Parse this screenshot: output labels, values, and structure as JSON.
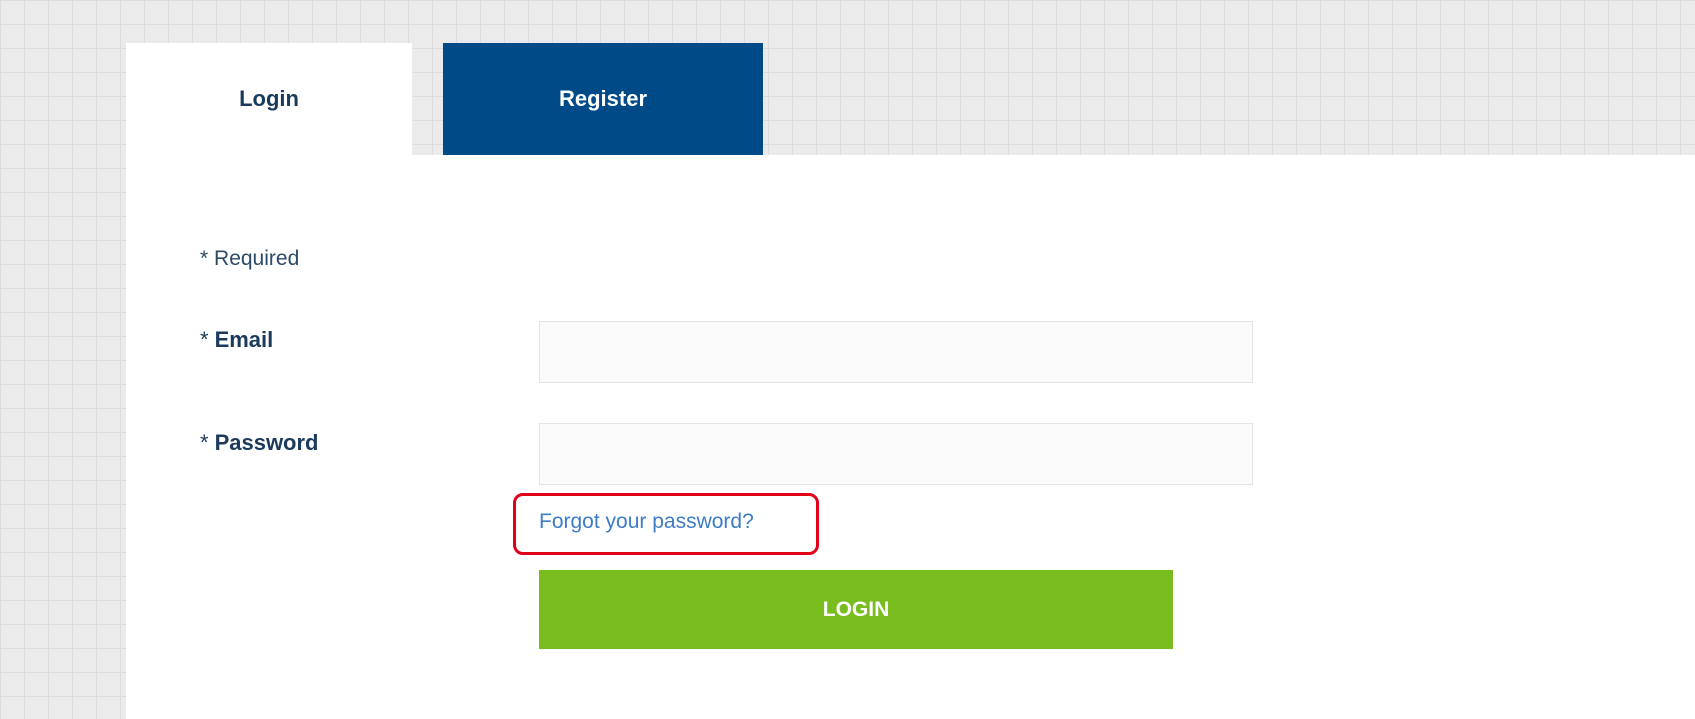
{
  "tabs": {
    "login_label": "Login",
    "register_label": "Register"
  },
  "form": {
    "required_marker": "*",
    "required_note": "Required",
    "email_label": "Email",
    "email_value": "",
    "password_label": "Password",
    "password_value": "",
    "forgot_link": "Forgot your password?",
    "login_button": "LOGIN"
  },
  "colors": {
    "brand_blue": "#004b87",
    "login_green": "#78bc1e",
    "link_blue": "#3d7cc6",
    "highlight_red": "#e0001a"
  }
}
